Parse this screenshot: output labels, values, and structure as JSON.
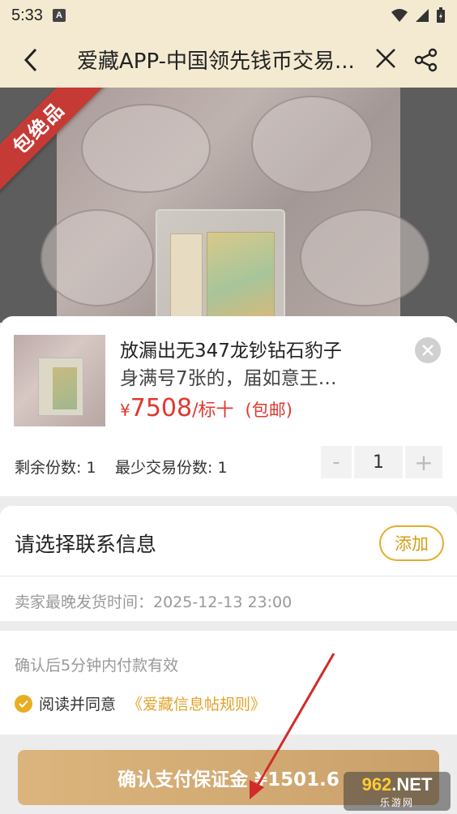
{
  "status_bar": {
    "time": "5:33",
    "notification_badge": "A"
  },
  "nav": {
    "title": "爱藏APP-中国领先钱币交易..."
  },
  "photo": {
    "ribbon_label": "包绝品"
  },
  "product": {
    "title_line1": "放漏出无347龙钞钻石豹子",
    "title_line2": "身满号7张的，届如意王…",
    "price_symbol": "¥",
    "price_value": "7508",
    "price_unit": "/标十",
    "shipping": "(包邮)"
  },
  "quantity": {
    "remaining": "剩余份数: 1",
    "minimum": "最少交易份数: 1",
    "minus_label": "-",
    "value": "1",
    "plus_label": "+"
  },
  "contact": {
    "label": "请选择联系信息",
    "add_label": "添加",
    "ship_time": "卖家最晚发货时间：2025-12-13 23:00"
  },
  "confirm": {
    "validity": "确认后5分钟内付款有效",
    "agree_text": "阅读并同意",
    "rules_link": "《爱藏信息帖规则》"
  },
  "pay_button": {
    "label": "确认支付保证金 ¥1501.6"
  },
  "watermark": {
    "num": "962",
    "suffix": ".NET",
    "sub": "乐游网"
  },
  "colors": {
    "accent": "#e2ad2a",
    "price_red": "#e2362e",
    "header_bg": "#f3ead1",
    "pay_button": "#d4ac74",
    "annotation_arrow": "#d32a2a"
  },
  "icons": [
    "back-arrow-icon",
    "close-icon",
    "share-icon",
    "close-circle-icon",
    "check-icon",
    "wifi-icon",
    "signal-icon",
    "battery-icon"
  ]
}
